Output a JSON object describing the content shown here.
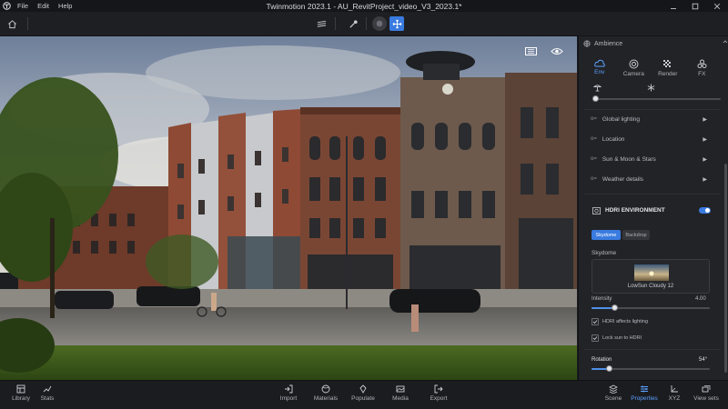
{
  "window": {
    "title": "Twinmotion 2023.1 - AU_RevitProject_video_V3_2023.1*",
    "menu": [
      "File",
      "Edit",
      "Help"
    ],
    "controls": [
      "minimize-icon",
      "maximize-icon",
      "close-icon"
    ]
  },
  "toolbar": {
    "home_icon": "home-icon",
    "tools": [
      "layers-icon",
      "pick-tool-icon",
      "orbit-icon",
      "move-icon"
    ]
  },
  "viewport": {
    "overlay_icons": [
      "fullscreen-icon",
      "eye-icon"
    ]
  },
  "panel": {
    "header": "Ambience",
    "tabs": [
      {
        "label": "Env",
        "icon": "cloud-icon",
        "active": true
      },
      {
        "label": "Camera",
        "icon": "camera-icon",
        "active": false
      },
      {
        "label": "Render",
        "icon": "render-icon",
        "active": false
      },
      {
        "label": "FX",
        "icon": "fx-icon",
        "active": false
      }
    ],
    "season_slider": {
      "value": 0.0
    },
    "sections": [
      "Global lighting",
      "Location",
      "Sun & Moon & Stars",
      "Weather details"
    ],
    "hdri": {
      "title": "HDRI ENVIRONMENT",
      "enabled": true,
      "modes": [
        "Skydome",
        "Backdrop"
      ],
      "active_mode": "Skydome",
      "skydome_label": "Skydome",
      "skydome_name": "LowSun Cloudy 12",
      "intensity_label": "Intensity",
      "intensity_value": "4.00",
      "intensity_fraction": 0.2,
      "checks": [
        {
          "label": "HDRI affects lighting",
          "checked": true
        },
        {
          "label": "Lock sun to HDRI",
          "checked": true
        }
      ],
      "rotation_label": "Rotation",
      "rotation_value": "54°",
      "rotation_fraction": 0.15
    }
  },
  "bottombar": {
    "left": [
      {
        "label": "Library",
        "icon": "library-icon"
      },
      {
        "label": "Stats",
        "icon": "stats-icon"
      }
    ],
    "center": [
      {
        "label": "Import",
        "icon": "import-icon"
      },
      {
        "label": "Materials",
        "icon": "materials-icon"
      },
      {
        "label": "Populate",
        "icon": "populate-icon"
      },
      {
        "label": "Media",
        "icon": "media-icon"
      },
      {
        "label": "Export",
        "icon": "export-icon"
      }
    ],
    "right": [
      {
        "label": "Scene",
        "icon": "scene-icon",
        "active": false
      },
      {
        "label": "Properties",
        "icon": "properties-icon",
        "active": true
      },
      {
        "label": "XYZ",
        "icon": "xyz-icon",
        "active": false
      },
      {
        "label": "View sets",
        "icon": "view-sets-icon",
        "active": false
      }
    ]
  },
  "colors": {
    "accent": "#4f8fe8",
    "panel": "#222327",
    "background": "#1c1d21"
  }
}
